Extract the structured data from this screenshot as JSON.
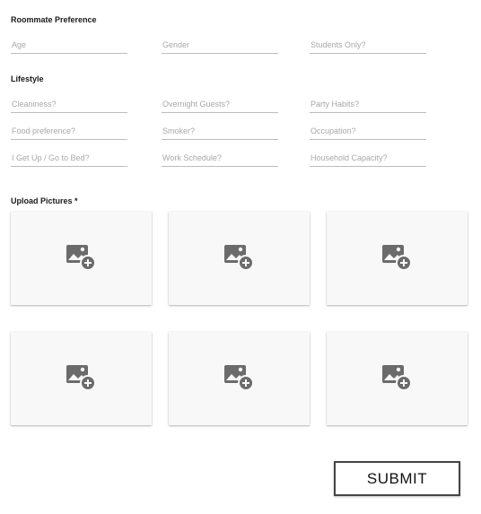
{
  "roommate_preference": {
    "title": "Roommate Preference",
    "fields": [
      {
        "placeholder": "Age",
        "value": ""
      },
      {
        "placeholder": "Gender",
        "value": ""
      },
      {
        "placeholder": "Students Only?",
        "value": ""
      }
    ]
  },
  "lifestyle": {
    "title": "Lifestyle",
    "fields": [
      {
        "placeholder": "Cleaniness?",
        "value": ""
      },
      {
        "placeholder": "Overnight Guests?",
        "value": ""
      },
      {
        "placeholder": "Party Habits?",
        "value": ""
      },
      {
        "placeholder": "Food preference?",
        "value": ""
      },
      {
        "placeholder": "Smoker?",
        "value": ""
      },
      {
        "placeholder": "Occupation?",
        "value": ""
      },
      {
        "placeholder": "I Get Up / Go to Bed?",
        "value": ""
      },
      {
        "placeholder": "Work Schedule?",
        "value": ""
      },
      {
        "placeholder": "Household Capacity?",
        "value": ""
      }
    ]
  },
  "upload": {
    "title": "Upload Pictures *",
    "slots": [
      {
        "icon": "add-photo-icon"
      },
      {
        "icon": "add-photo-icon"
      },
      {
        "icon": "add-photo-icon"
      },
      {
        "icon": "add-photo-icon"
      },
      {
        "icon": "add-photo-icon"
      },
      {
        "icon": "add-photo-icon"
      }
    ]
  },
  "submit": {
    "label": "SUBMIT"
  },
  "colors": {
    "icon": "#6b6b6b",
    "tile_bg": "#f8f8f8",
    "underline": "#bdbdbd",
    "placeholder": "#a8a8a8"
  }
}
